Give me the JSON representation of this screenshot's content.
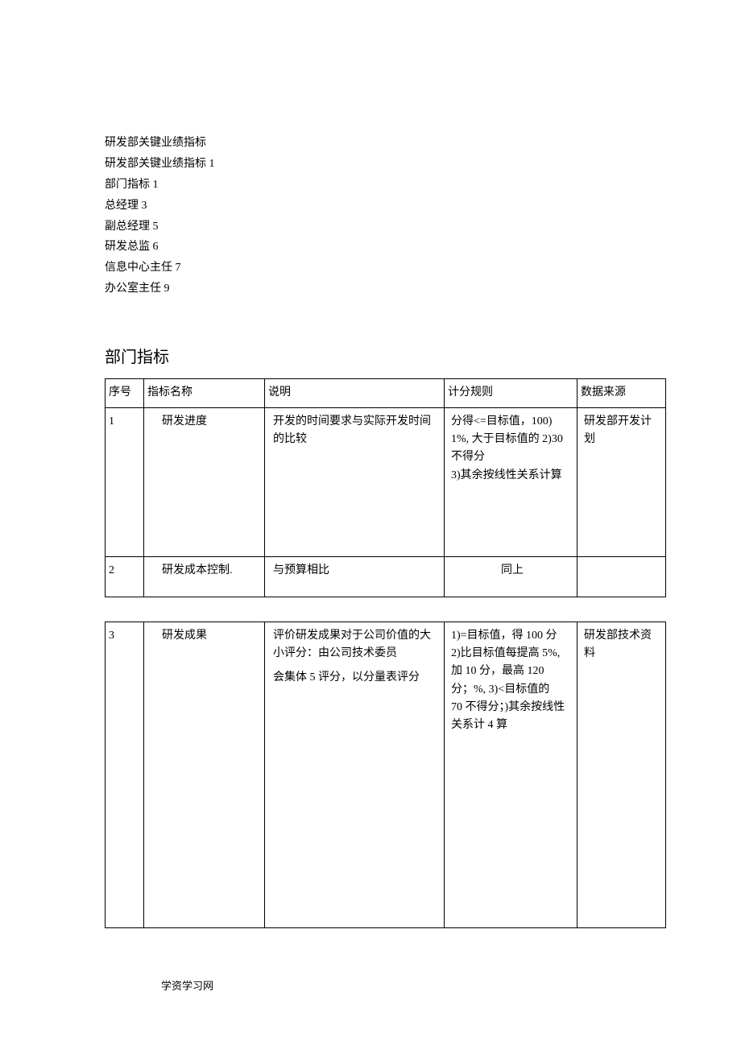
{
  "header": {
    "line1": "研发部关键业绩指标",
    "line2": "研发部关键业绩指标 1",
    "line3": "部门指标 1",
    "line4": "总经理 3",
    "line5": "副总经理 5",
    "line6": "研发总监 6",
    "line7": "信息中心主任 7",
    "line8": "办公室主任 9"
  },
  "section_title": "部门指标",
  "columns": {
    "seq": "序号",
    "name": "指标名称",
    "desc": "说明",
    "rule": "计分规则",
    "source": "数据来源"
  },
  "rows": [
    {
      "seq": "1",
      "name": "研发进度",
      "desc": "开发的时间要求与实际开发时间的比较",
      "rule": " 分得<=目标值，100)\n1%, 大于目标值的 2)30 不得分\n3)其余按线性关系计算",
      "source": "研发部开发计划"
    },
    {
      "seq": "2",
      "name": "研发成本控制.",
      "desc": "与预算相比",
      "rule": "同上",
      "source": ""
    },
    {
      "seq": "3",
      "name": "研发成果",
      "desc_p1": "评价研发成果对于公司价值的大小评分：由公司技术委员",
      "desc_p2": "会集体 5 评分，以分量表评分",
      "rule": "1)=目标值，得 100 分\n2)比目标值每提高 5%, 加 10 分，最高 120\n分；%, 3)<目标值的\n70 不得分；)其余按线性关系计 4 算",
      "source": "研发部技术资料"
    }
  ],
  "footer": "学资学习网"
}
